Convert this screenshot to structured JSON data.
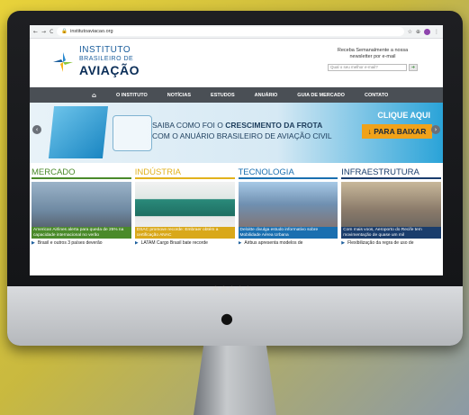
{
  "browser": {
    "url": "institutoaviacao.org",
    "nav_icons": [
      "←",
      "→",
      "C"
    ],
    "right_icons": [
      "☆",
      "⊕",
      "●"
    ]
  },
  "site": {
    "logo": {
      "line1": "INSTITUTO",
      "line2": "BRASILEIRO DE",
      "line3": "AVIAÇÃO"
    },
    "newsletter": {
      "text": "Receba Semanalmente a nossa newsletter por e-mail",
      "placeholder": "Qual o seu melhor e-mail?",
      "button": "➜"
    },
    "nav": {
      "home_icon": "⌂",
      "items": [
        "O INSTITUTO",
        "NOTÍCIAS",
        "ESTUDOS",
        "ANUÁRIO",
        "GUIA DE MERCADO",
        "CONTATO"
      ]
    },
    "banner": {
      "line1_a": "SAIBA COMO FOI O ",
      "line1_b": "CRESCIMENTO DA FROTA",
      "line2": "COM O ANUÁRIO BRASILEIRO DE AVIAÇÃO CIVIL",
      "cta_top": "CLIQUE AQUI",
      "cta_button": "↓ PARA BAIXAR",
      "prev": "‹",
      "next": "›"
    },
    "sections": [
      {
        "title": "MERCADO",
        "color": "#4a8a2a",
        "caption": "American Airlines alerta para queda de 25% na capacidade internacional no verão",
        "caption_bg": "#4a8a2a",
        "news": "Brasil e outros 3 países deverão"
      },
      {
        "title": "INDÚSTRIA",
        "color": "#e2b21c",
        "caption": "DSAC promove recorde: Embraer obtém a certificação ANAC",
        "caption_bg": "#d9a81a",
        "news": "LATAM Cargo Brasil bate recorde"
      },
      {
        "title": "TECNOLOGIA",
        "color": "#1a6fb0",
        "caption": "Deloitte divulga estudo informativo sobre Mobilidade Aérea Urbana",
        "caption_bg": "#1a6fb0",
        "news": "Airbus apresenta modelos de"
      },
      {
        "title": "INFRAESTRUTURA",
        "color": "#1a3d6c",
        "caption": "Com mais voos, Aeroporto do Recife tem movimentação de quase um mil",
        "caption_bg": "#1a3d6c",
        "news": "Flexibilização da regra de uso de"
      }
    ]
  }
}
